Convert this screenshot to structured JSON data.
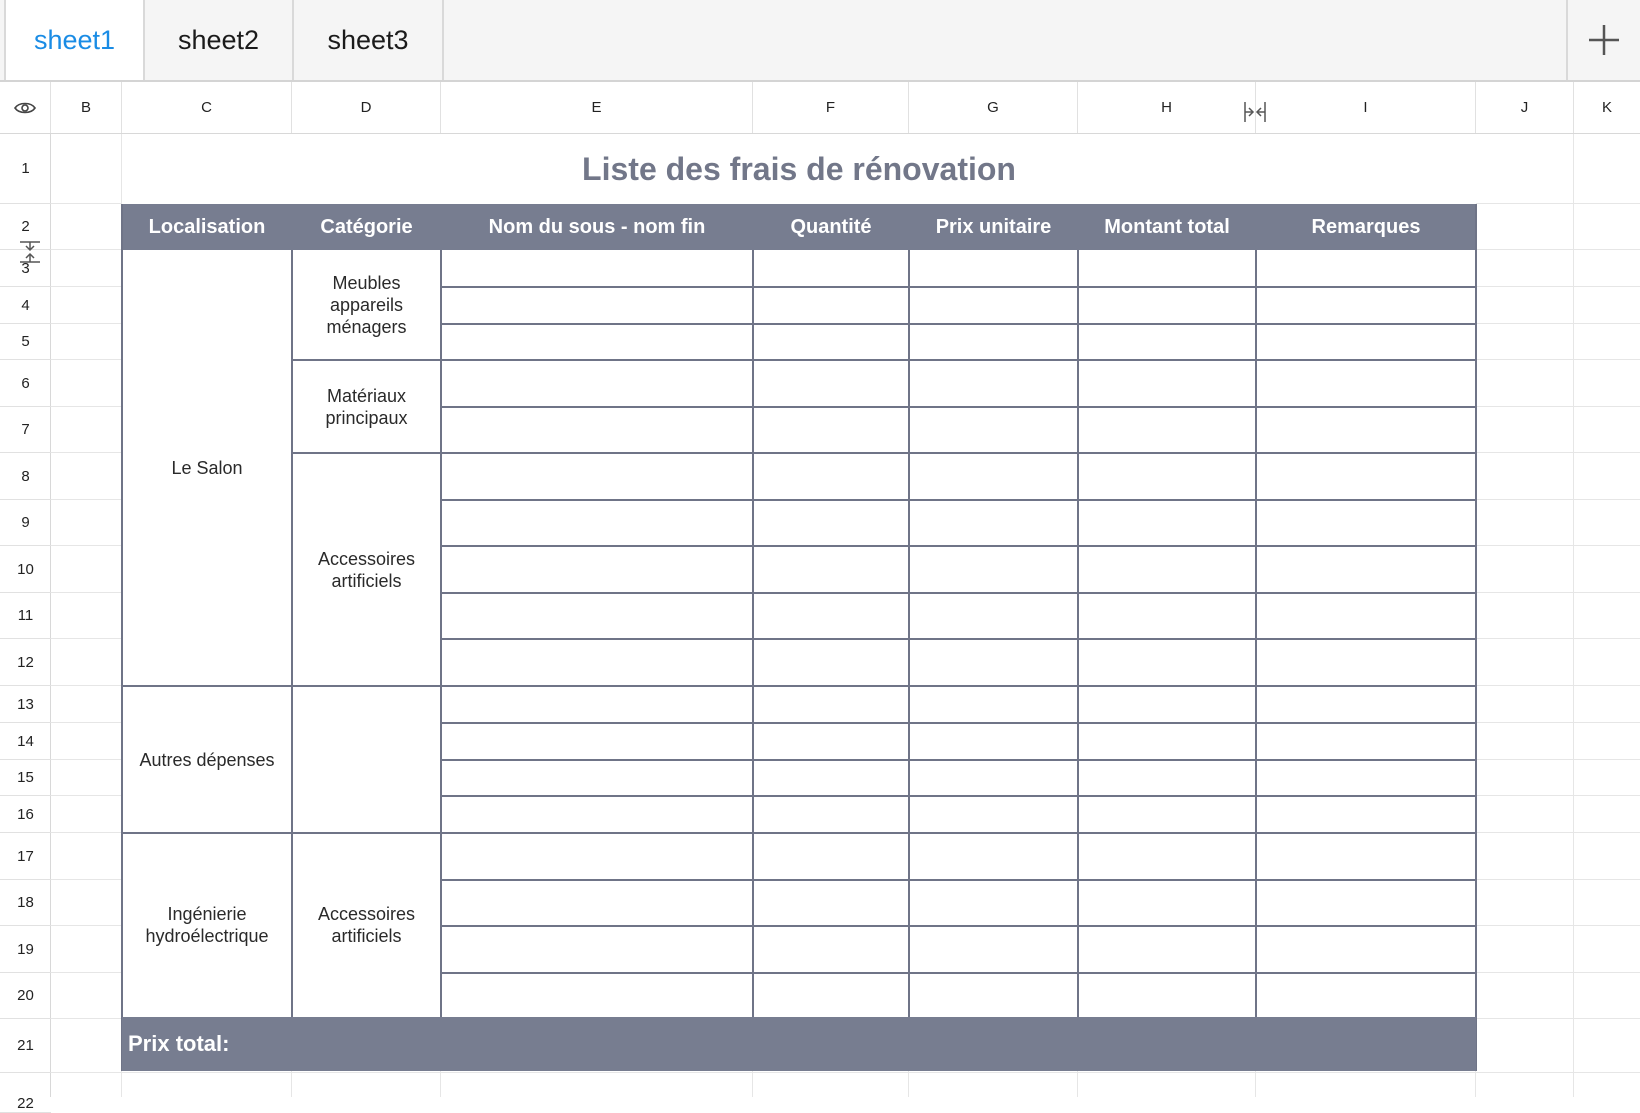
{
  "tabs": [
    {
      "label": "sheet1",
      "active": true
    },
    {
      "label": "sheet2",
      "active": false
    },
    {
      "label": "sheet3",
      "active": false
    }
  ],
  "column_headers": [
    "B",
    "C",
    "D",
    "E",
    "F",
    "G",
    "H",
    "I",
    "J",
    "K"
  ],
  "row_headers": [
    "1",
    "2",
    "3",
    "4",
    "5",
    "6",
    "7",
    "8",
    "9",
    "10",
    "11",
    "12",
    "13",
    "14",
    "15",
    "16",
    "17",
    "18",
    "19",
    "20",
    "21",
    "22"
  ],
  "sheet": {
    "title": "Liste des frais de rénovation",
    "headers": [
      "Localisation",
      "Catégorie",
      "Nom du sous - nom fin",
      "Quantité",
      "Prix unitaire",
      "Montant total",
      "Remarques"
    ],
    "locations": [
      "Le Salon",
      "Autres dépenses",
      "Ingénierie hydroélectrique"
    ],
    "categories": [
      "Meubles appareils ménagers",
      "Matériaux principaux",
      "Accessoires artificiels",
      "",
      "Accessoires artificiels"
    ],
    "total_label": "Prix total:"
  },
  "colors": {
    "accent": "#1a8ce5",
    "table_header_bg": "#777d90",
    "title_color": "#727789"
  },
  "icons": {
    "visibility": "eye-icon",
    "add": "plus-icon",
    "column_resize": "column-resize-icon",
    "row_resize": "row-resize-icon"
  }
}
